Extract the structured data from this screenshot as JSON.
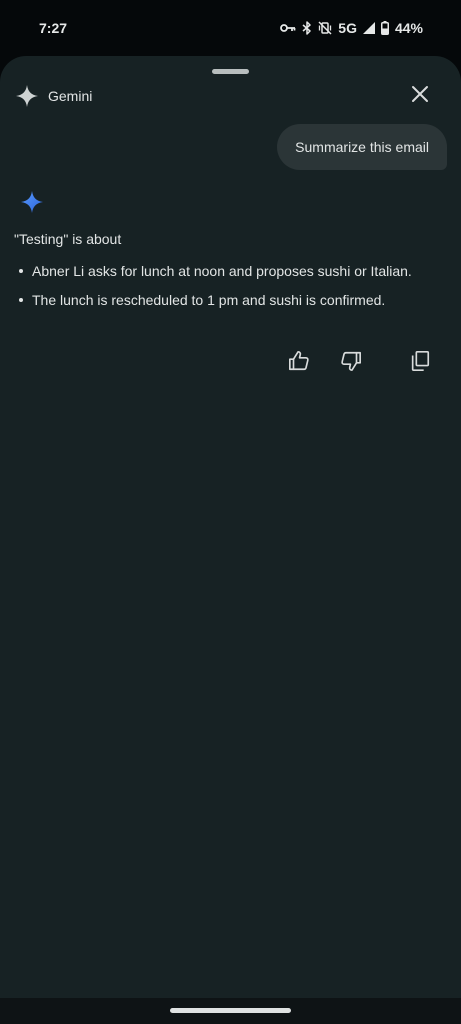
{
  "status_bar": {
    "time": "7:27",
    "network": "5G",
    "battery": "44%",
    "icons": [
      "vpn-key-icon",
      "bluetooth-icon",
      "vibrate-off-icon",
      "signal-icon",
      "battery-icon"
    ]
  },
  "header": {
    "title": "Gemini",
    "icon": "gemini-spark-icon",
    "close_icon": "close-icon"
  },
  "conversation": {
    "user_prompt": "Summarize this email",
    "response_intro": "\"Testing\" is about",
    "response_points": [
      "Abner Li asks for lunch at noon and proposes sushi or Italian.",
      "The lunch is rescheduled to 1 pm and sushi is confirmed."
    ]
  },
  "actions": {
    "icons": [
      "thumbs-up-icon",
      "thumbs-down-icon",
      "copy-icon"
    ]
  },
  "colors": {
    "background": "#05080a",
    "sheet": "#172224",
    "bubble": "#2b3537",
    "text": "#e2e5e5",
    "spark_blue": "#3b7cf0"
  }
}
